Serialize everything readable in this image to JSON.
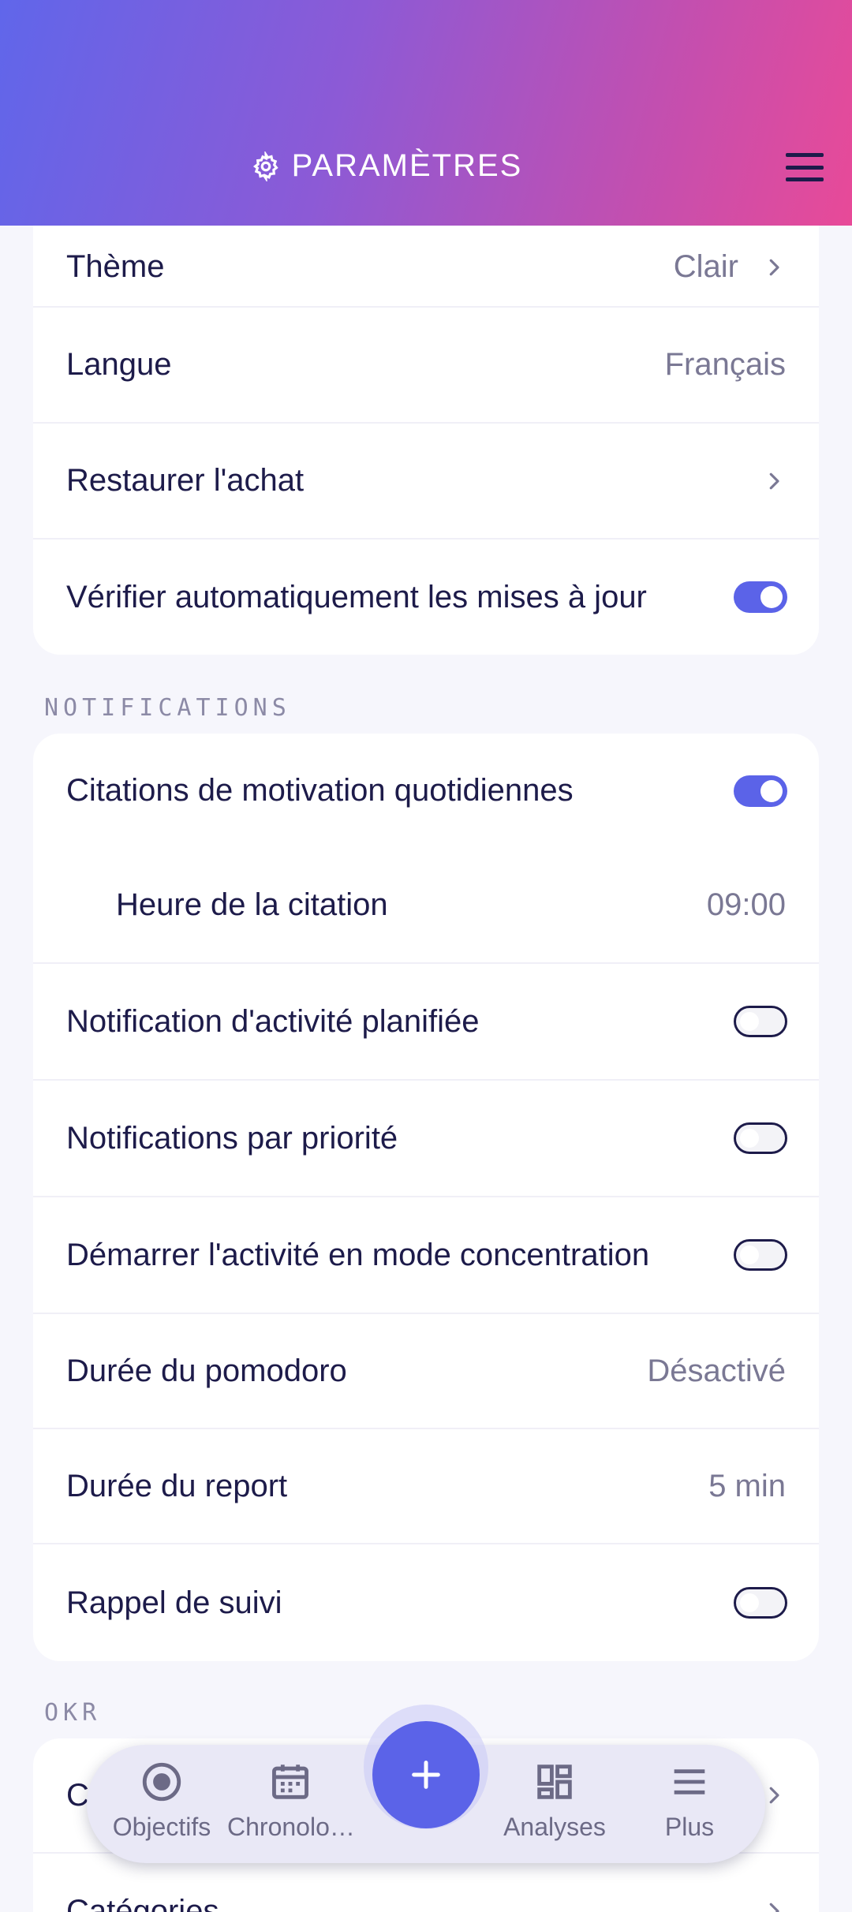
{
  "header": {
    "title": "PARAMÈTRES"
  },
  "general": {
    "theme": {
      "label": "Thème",
      "value": "Clair"
    },
    "language": {
      "label": "Langue",
      "value": "Français"
    },
    "restore": {
      "label": "Restaurer l'achat"
    },
    "auto_update": {
      "label": "Vérifier automatiquement les mises à jour",
      "enabled": true
    }
  },
  "notifications": {
    "section_label": "NOTIFICATIONS",
    "daily_quotes": {
      "label": "Citations de motivation quotidiennes",
      "enabled": true
    },
    "quote_time": {
      "label": "Heure de la citation",
      "value": "09:00"
    },
    "planned_activity": {
      "label": "Notification d'activité planifiée",
      "enabled": false
    },
    "priority": {
      "label": "Notifications par priorité",
      "enabled": false
    },
    "focus_mode": {
      "label": "Démarrer l'activité en mode concentration",
      "enabled": false
    },
    "pomodoro": {
      "label": "Durée du pomodoro",
      "value": "Désactivé"
    },
    "snooze": {
      "label": "Durée du report",
      "value": "5 min"
    },
    "follow_up": {
      "label": "Rappel de suivi",
      "enabled": false
    }
  },
  "okr": {
    "section_label": "OKR",
    "first_item_partial": "C",
    "categories": {
      "label": "Catégories"
    }
  },
  "bottom_nav": {
    "items": [
      {
        "label": "Objectifs",
        "icon": "target-icon"
      },
      {
        "label": "Chronolo…",
        "icon": "calendar-icon"
      },
      {
        "label": "Analyses",
        "icon": "dashboard-icon"
      },
      {
        "label": "Plus",
        "icon": "menu-icon"
      }
    ],
    "fab_icon": "plus-icon"
  },
  "colors": {
    "accent": "#5b63e8",
    "text": "#1d1b4a",
    "muted": "#7a7894",
    "header_start": "#6066ea",
    "header_end": "#e84a98"
  }
}
